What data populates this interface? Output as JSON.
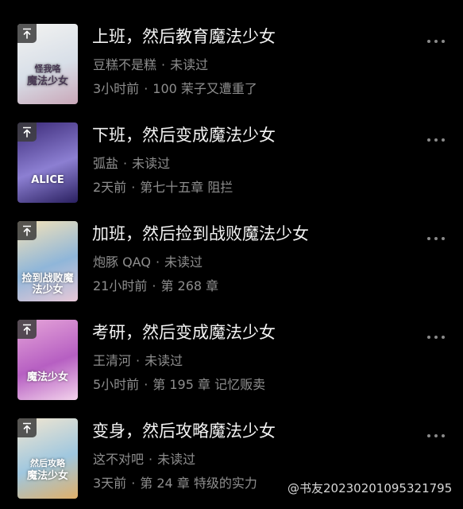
{
  "books": [
    {
      "title": "上班，然后教育魔法少女",
      "author": "豆糕不是糕",
      "read_status": "未读过",
      "updated": "3小时前",
      "latest_chapter": "100 茉子又遭重了",
      "cover_text_top": "怪我咯",
      "cover_text_bottom": "魔法少女",
      "cover_colors": [
        "#f3f3f1",
        "#d8dfe8",
        "#c9a7b8"
      ],
      "cover_text_color": "#4a3a55"
    },
    {
      "title": "下班，然后变成魔法少女",
      "author": "弧盐",
      "read_status": "未读过",
      "updated": "2天前",
      "latest_chapter": "第七十五章 阻拦",
      "cover_text_top": "",
      "cover_text_bottom": "ALICE",
      "cover_colors": [
        "#3b2a78",
        "#8c7fd2",
        "#2a2060"
      ],
      "cover_text_color": "#ffffff"
    },
    {
      "title": "加班，然后捡到战败魔法少女",
      "author": "炮豚 QAQ",
      "read_status": "未读过",
      "updated": "21小时前",
      "latest_chapter": "第 268 章",
      "cover_text_top": "",
      "cover_text_bottom": "捡到战败魔法少女",
      "cover_colors": [
        "#f5e3b8",
        "#8fb6d9",
        "#e8c8d8"
      ],
      "cover_text_color": "#ffffff"
    },
    {
      "title": "考研，然后变成魔法少女",
      "author": "王清河",
      "read_status": "未读过",
      "updated": "5小时前",
      "latest_chapter": "第 195 章 记忆贩卖",
      "cover_text_top": "",
      "cover_text_bottom": "魔法少女",
      "cover_colors": [
        "#e6a5d9",
        "#b65fc2",
        "#f3d3ec"
      ],
      "cover_text_color": "#ffffff"
    },
    {
      "title": "变身，然后攻略魔法少女",
      "author": "这不对吧",
      "read_status": "未读过",
      "updated": "3天前",
      "latest_chapter": "第 24 章 特级的实力",
      "cover_text_top": "然后攻略",
      "cover_text_bottom": "魔法少女",
      "cover_colors": [
        "#f2e6d0",
        "#9fc7df",
        "#e0b06a"
      ],
      "cover_text_color": "#ffffff"
    }
  ],
  "separator": "·",
  "pin_icon": "pin-to-top-icon",
  "more_icon": "more-dots-icon",
  "watermark": "@书友20230201095321795"
}
